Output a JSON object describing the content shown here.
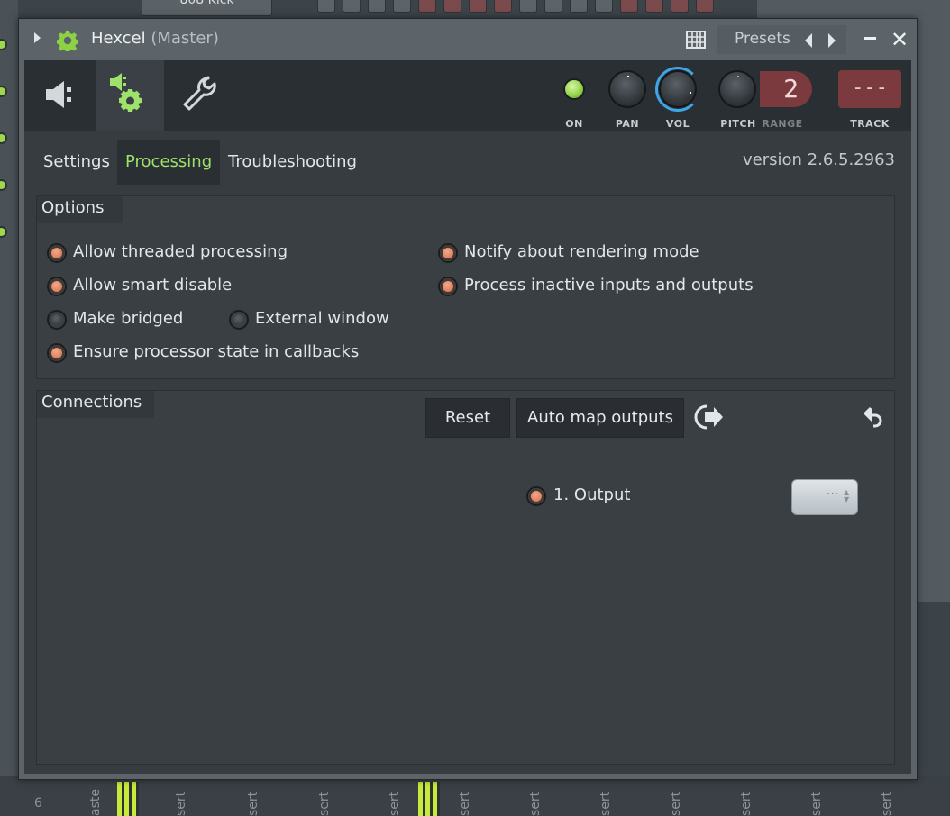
{
  "background": {
    "kick_label": "808 Kick",
    "mixer_channels": [
      "6",
      "aste",
      "sert",
      "sert",
      "sert",
      "sert",
      "sert",
      "sert",
      "sert",
      "sert",
      "sert",
      "sert",
      "sert",
      "sert"
    ]
  },
  "window": {
    "title": "Hexcel",
    "subtitle": "(Master)",
    "presets_label": "Presets",
    "close_glyph": "✕"
  },
  "toolbar": {
    "on_label": "ON",
    "pan_label": "PAN",
    "vol_label": "VOL",
    "pitch_label": "PITCH",
    "range_label": "RANGE",
    "range_value": "2",
    "track_label": "TRACK",
    "track_value": "---",
    "icons": [
      "plug-icon",
      "processing-gear-icon",
      "wrench-icon"
    ]
  },
  "tabs": {
    "settings": "Settings",
    "processing": "Processing",
    "troubleshooting": "Troubleshooting",
    "active": "Processing",
    "version": "version 2.6.5.2963"
  },
  "options": {
    "title": "Options",
    "allow_threaded": "Allow threaded processing",
    "notify_rendering": "Notify about rendering mode",
    "allow_smart": "Allow smart disable",
    "process_inactive": "Process inactive inputs and outputs",
    "make_bridged": "Make bridged",
    "external_window": "External window",
    "ensure_state": "Ensure processor state in callbacks",
    "states": {
      "allow_threaded": true,
      "notify_rendering": true,
      "allow_smart": true,
      "process_inactive": true,
      "make_bridged": false,
      "external_window": false,
      "ensure_state": true
    }
  },
  "connections": {
    "title": "Connections",
    "reset": "Reset",
    "auto_map": "Auto map outputs",
    "output_label": "1. Output",
    "output_combo_value": "···"
  },
  "colors": {
    "accent_green": "#9fe26a",
    "radio_on": "#d86e4c",
    "knob_blue": "#3ea5e8",
    "track_red": "#7a3a3e"
  }
}
